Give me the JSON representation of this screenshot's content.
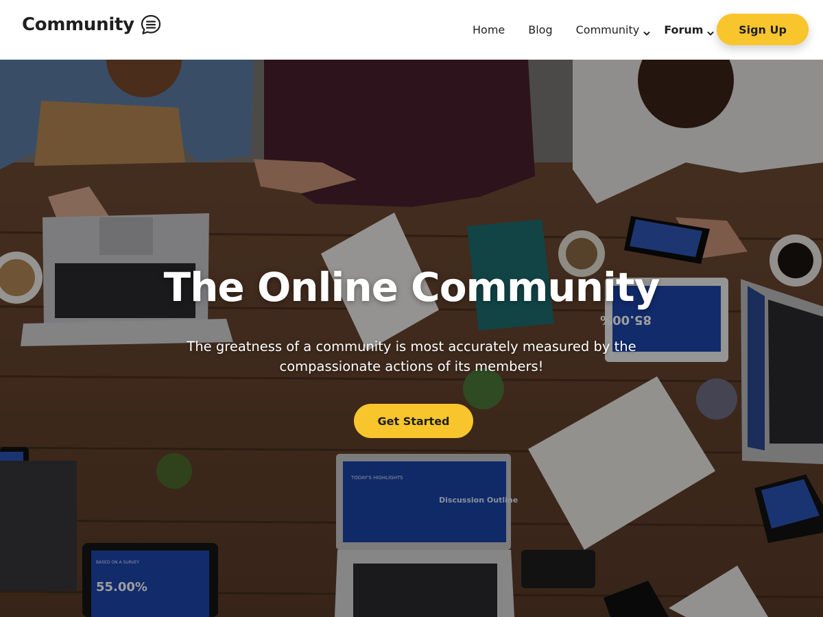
{
  "header": {
    "logo_text": "Community",
    "logo_icon": "chat-bubble-icon",
    "nav": [
      {
        "label": "Home",
        "has_dropdown": false
      },
      {
        "label": "Blog",
        "has_dropdown": false
      },
      {
        "label": "Community",
        "has_dropdown": true
      },
      {
        "label": "Forum",
        "has_dropdown": true
      }
    ],
    "signup_label": "Sign Up"
  },
  "hero": {
    "title": "The Online Community",
    "subtitle": "The greatness of a community is most accurately measured by the compassionate actions of its members!",
    "cta_label": "Get Started",
    "screen_texts": [
      "85.00%",
      "TODAY'S HIGHLIGHTS",
      "Discussion Outline",
      "BASED ON A SURVEY",
      "55.00%"
    ]
  },
  "colors": {
    "accent": "#f8c52c",
    "header_bg": "#ffffff",
    "text_dark": "#1f1f1f",
    "hero_text": "#ffffff"
  }
}
